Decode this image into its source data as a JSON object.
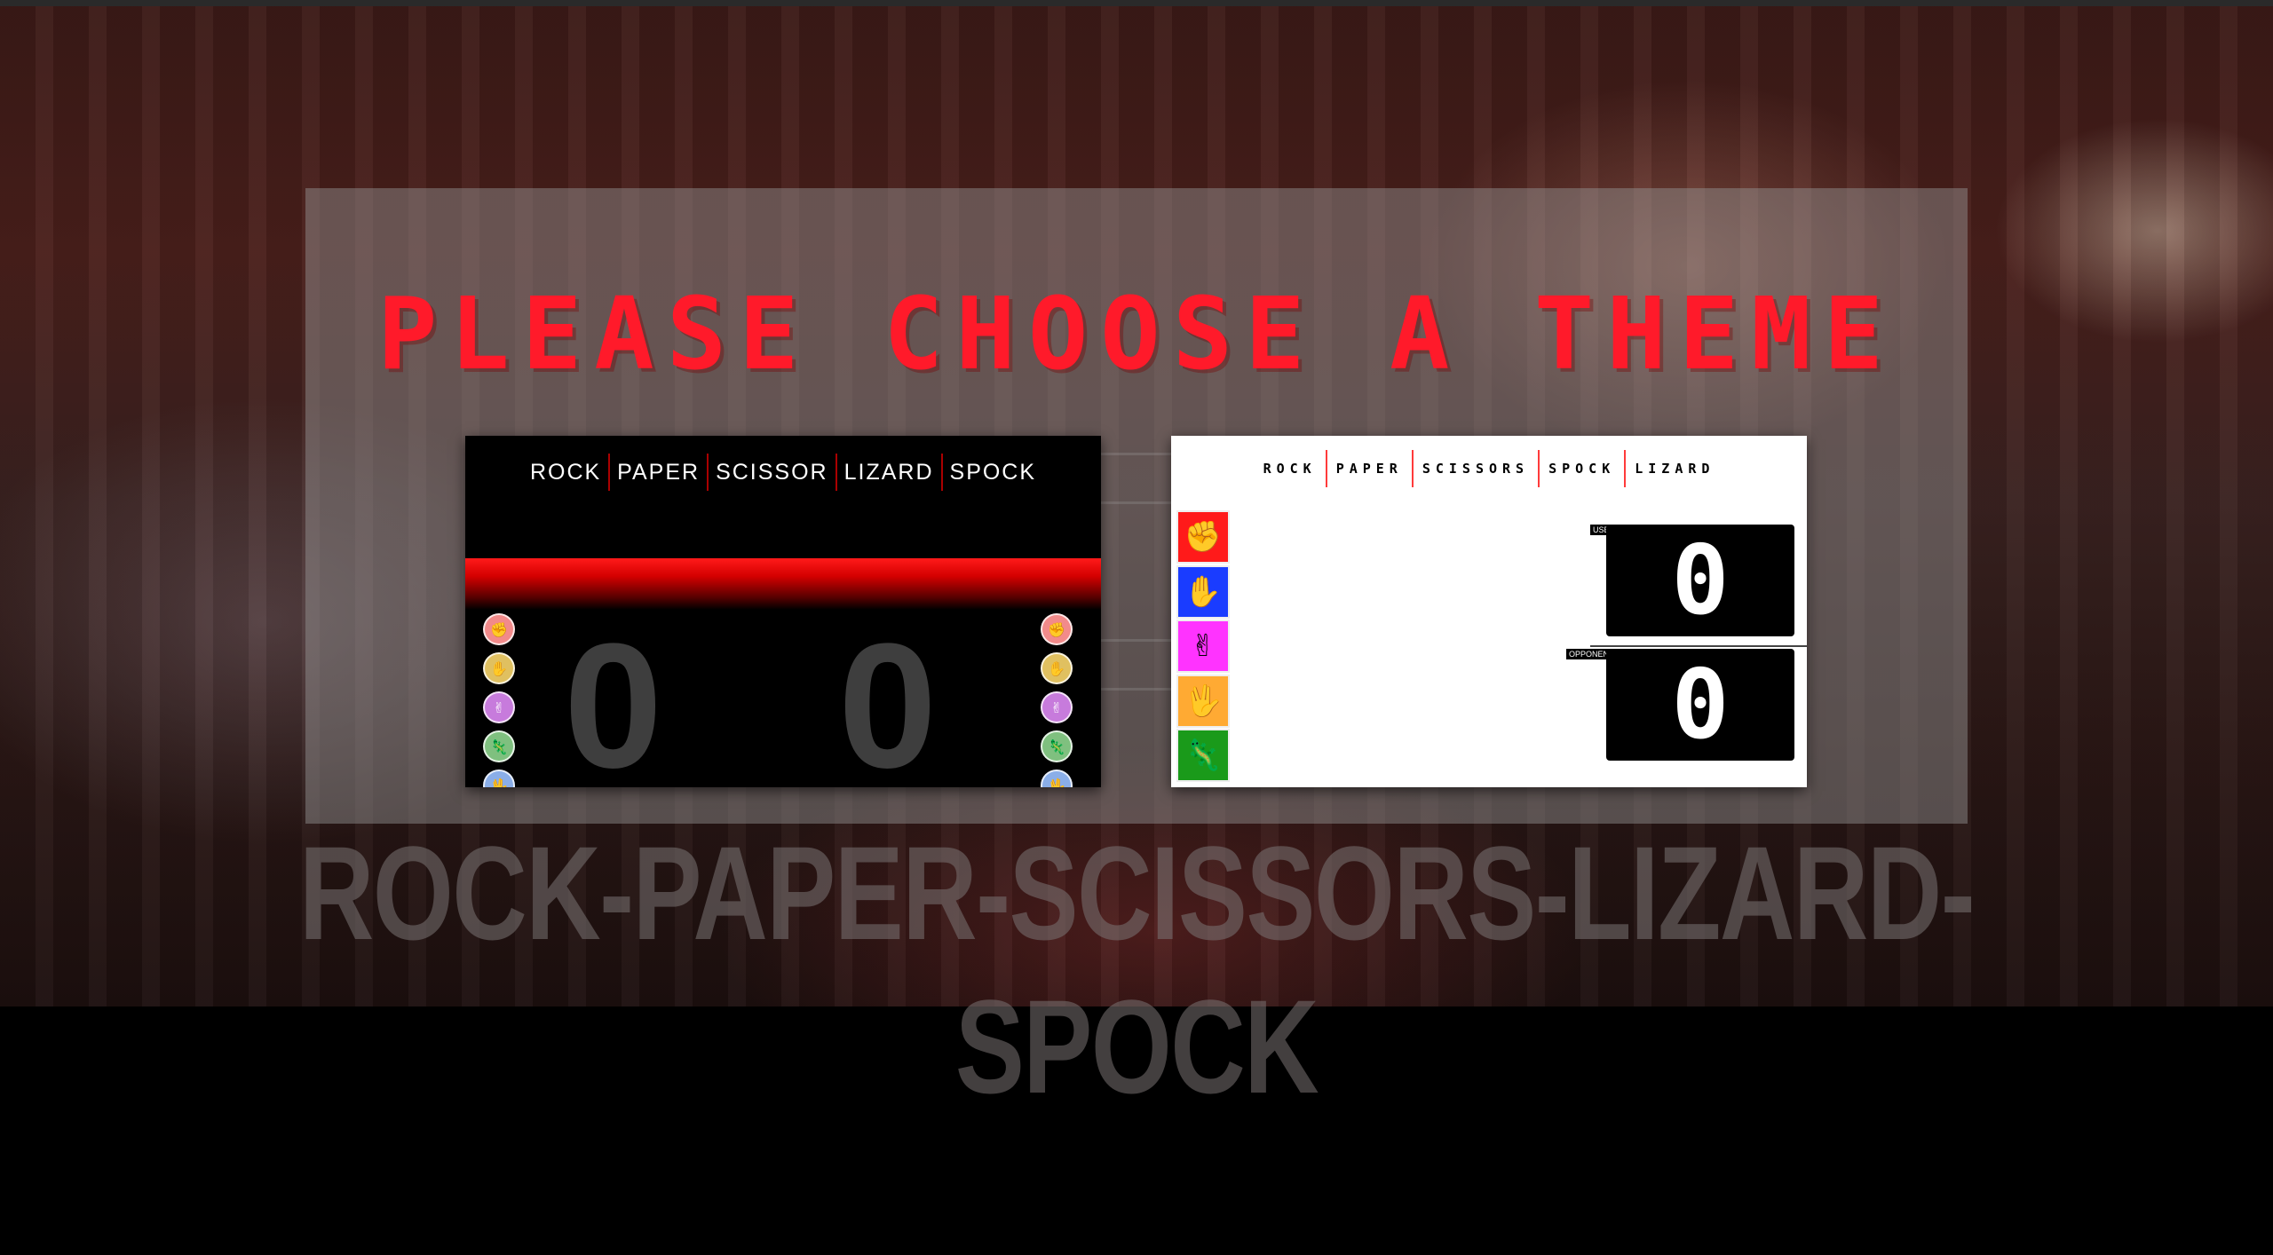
{
  "background": {
    "game_title": "ROCK-PAPER-SCISSORS-LIZARD-SPOCK"
  },
  "modal": {
    "title": "PLEASE CHOOSE A THEME",
    "title_color": "#ff1a2a"
  },
  "theme_dark": {
    "nav": [
      "ROCK",
      "PAPER",
      "SCISSOR",
      "LIZARD",
      "SPOCK"
    ],
    "score_left": "0",
    "score_right": "0",
    "gesture_colors": [
      "#f28a8a",
      "#e0c060",
      "#c77bdc",
      "#7fc07f",
      "#8aaee8"
    ],
    "accent": "#ff1a1a"
  },
  "theme_light": {
    "nav": [
      "ROCK",
      "PAPER",
      "SCISSORS",
      "SPOCK",
      "LIZARD"
    ],
    "choices": [
      {
        "name": "rock",
        "color": "#ff1a1a",
        "glyph": "✊"
      },
      {
        "name": "paper",
        "color": "#1a3cff",
        "glyph": "✋"
      },
      {
        "name": "scissors",
        "color": "#ff33ff",
        "glyph": "✌"
      },
      {
        "name": "spock",
        "color": "#ffaa33",
        "glyph": "🖖"
      },
      {
        "name": "lizard",
        "color": "#1a9a1a",
        "glyph": "🦎"
      }
    ],
    "user_label": "USER",
    "user_score": "0",
    "opponent_label": "OPPONENT",
    "opponent_score": "0"
  }
}
